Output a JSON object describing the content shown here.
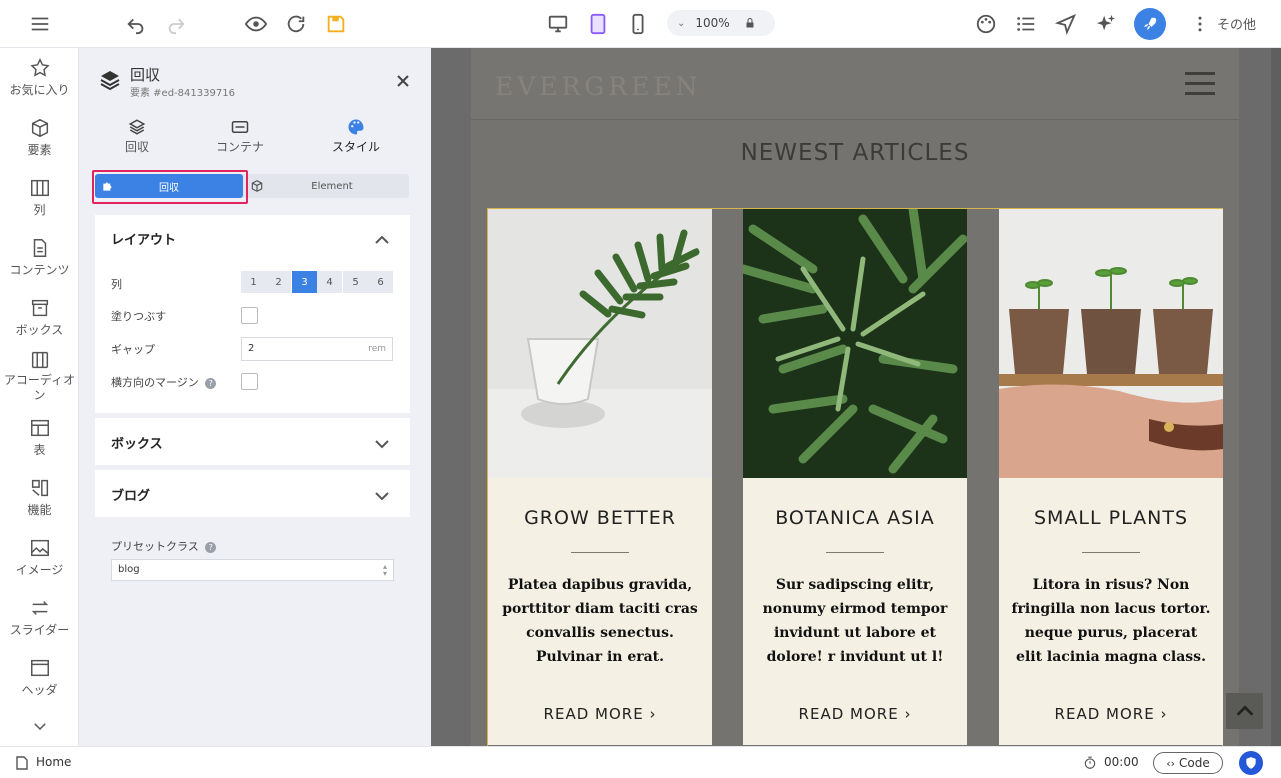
{
  "toolbar": {
    "zoom": "100%",
    "more_label": "その他"
  },
  "leftnav": {
    "items": [
      {
        "label": "お気に入り",
        "icon": "star-icon"
      },
      {
        "label": "要素",
        "icon": "cube-icon"
      },
      {
        "label": "列",
        "icon": "columns-icon"
      },
      {
        "label": "コンテンツ",
        "icon": "document-icon"
      },
      {
        "label": "ボックス",
        "icon": "box-icon"
      },
      {
        "label": "アコーディオン",
        "icon": "accordion-icon"
      },
      {
        "label": "表",
        "icon": "table-icon"
      },
      {
        "label": "機能",
        "icon": "features-icon"
      },
      {
        "label": "イメージ",
        "icon": "image-icon"
      },
      {
        "label": "スライダー",
        "icon": "slider-icon"
      },
      {
        "label": "ヘッダ",
        "icon": "header-icon"
      }
    ]
  },
  "panel": {
    "title": "回収",
    "subtitle": "要素 #ed-841339716",
    "tabs": [
      "回収",
      "コンテナ",
      "スタイル"
    ],
    "segment": {
      "left": "回収",
      "right": "Element"
    },
    "layout": {
      "heading": "レイアウト",
      "columns_label": "列",
      "columns": [
        "1",
        "2",
        "3",
        "4",
        "5",
        "6"
      ],
      "selected_column": "3",
      "fill_label": "塗りつぶす",
      "gap_label": "ギャップ",
      "gap_value": "2",
      "gap_unit": "rem",
      "margin_label": "横方向のマージン"
    },
    "box_heading": "ボックス",
    "blog_heading": "ブログ",
    "preset_label": "プリセットクラス",
    "preset_value": "blog"
  },
  "site": {
    "logo": "EVERGREEN",
    "section_title": "NEWEST ARTICLES",
    "posts": [
      {
        "title": "GROW BETTER",
        "text": "Platea dapibus gravida, porttitor diam taciti cras convallis senectus. Pulvinar in erat.",
        "link": "READ MORE ›"
      },
      {
        "title": "BOTANICA ASIA",
        "text": "Sur sadipscing elitr, nonumy eirmod tempor invidunt ut labore et dolore! r invidunt ut l!",
        "link": "READ MORE ›"
      },
      {
        "title": "SMALL PLANTS",
        "text": "Litora in risus? Non fringilla non lacus tortor. neque purus, placerat elit lacinia magna class.",
        "link": "READ MORE ›"
      }
    ]
  },
  "status": {
    "page": "Home",
    "timer": "00:00",
    "code_label": "Code"
  },
  "colors": {
    "accent": "#3b82e4",
    "highlight": "#e0245e",
    "save": "#f2b01e"
  }
}
